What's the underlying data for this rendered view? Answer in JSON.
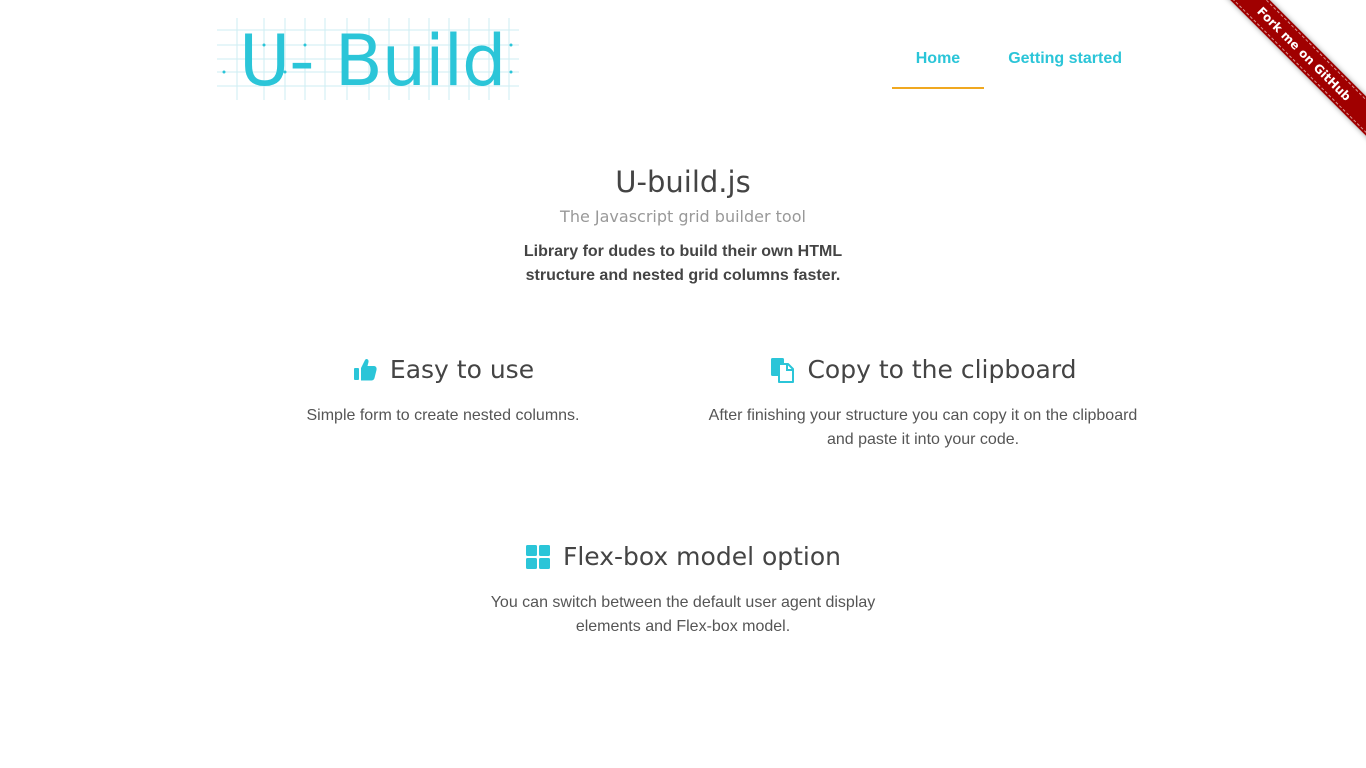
{
  "logo": {
    "text": "U- Build"
  },
  "nav": {
    "items": [
      {
        "label": "Home",
        "active": true
      },
      {
        "label": "Getting started",
        "active": false
      }
    ]
  },
  "ribbon": {
    "label": "Fork me on GitHub"
  },
  "hero": {
    "title": "U-build.js",
    "subtitle": "The Javascript grid builder tool",
    "description": "Library for dudes to build their own HTML structure and nested grid columns faster."
  },
  "features": [
    {
      "icon": "thumbs-up-icon",
      "title": "Easy to use",
      "description": "Simple form to create nested columns."
    },
    {
      "icon": "clipboard-icon",
      "title": "Copy to the clipboard",
      "description": "After finishing your structure you can copy it on the clipboard and paste it into your code."
    },
    {
      "icon": "grid-icon",
      "title": "Flex-box model option",
      "description": "You can switch between the default user agent display elements and Flex-box model."
    }
  ],
  "colors": {
    "accent": "#2bc5d8",
    "nav_active_underline": "#f0a820",
    "ribbon": "#a00000",
    "text": "#444444",
    "muted": "#999999"
  }
}
